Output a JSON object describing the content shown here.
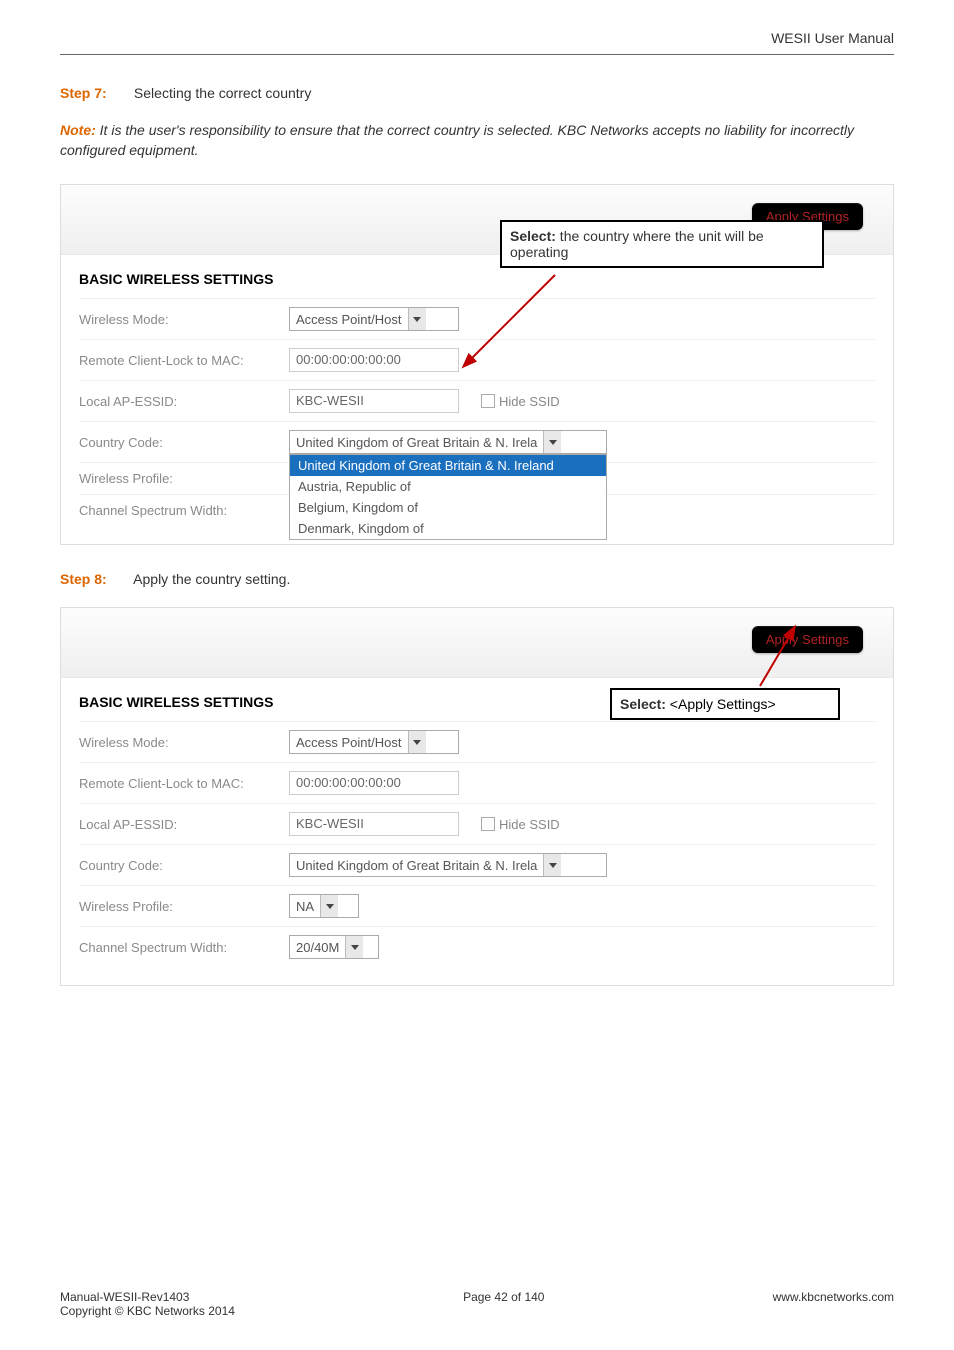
{
  "header": {
    "manual_title": "WESII User Manual"
  },
  "step7": {
    "label": "Step 7:",
    "text": "Selecting the correct country"
  },
  "note": {
    "label": "Note:",
    "text": "It is the user's responsibility to ensure that the correct country is selected. KBC Networks accepts no liability for incorrectly configured equipment."
  },
  "panel1": {
    "apply_label": "Apply Settings",
    "section_title": "BASIC WIRELESS SETTINGS",
    "rows": {
      "wireless_mode": {
        "label": "Wireless Mode:",
        "value": "Access Point/Host"
      },
      "remote_mac": {
        "label": "Remote Client-Lock to MAC:",
        "value": "00:00:00:00:00:00"
      },
      "local_essid": {
        "label": "Local AP-ESSID:",
        "value": "KBC-WESII",
        "hide_ssid": "Hide SSID"
      },
      "country_code": {
        "label": "Country Code:",
        "value": "United Kingdom of Great Britain & N. Irela"
      },
      "wireless_profile": {
        "label": "Wireless Profile:"
      },
      "channel_width": {
        "label": "Channel Spectrum Width:"
      }
    },
    "dropdown": {
      "opt_selected": "United Kingdom of Great Britain & N. Ireland",
      "opt2": "Austria, Republic of",
      "opt3": "Belgium, Kingdom of",
      "opt4": "Denmark, Kingdom of"
    },
    "callout": {
      "bold": "Select:",
      "text": " the country where the unit will be operating"
    }
  },
  "step8": {
    "label": "Step 8:",
    "text": "Apply the country setting."
  },
  "panel2": {
    "apply_label": "Apply Settings",
    "section_title": "BASIC WIRELESS SETTINGS",
    "rows": {
      "wireless_mode": {
        "label": "Wireless Mode:",
        "value": "Access Point/Host"
      },
      "remote_mac": {
        "label": "Remote Client-Lock to MAC:",
        "value": "00:00:00:00:00:00"
      },
      "local_essid": {
        "label": "Local AP-ESSID:",
        "value": "KBC-WESII",
        "hide_ssid": "Hide SSID"
      },
      "country_code": {
        "label": "Country Code:",
        "value": "United Kingdom of Great Britain & N. Irela"
      },
      "wireless_profile": {
        "label": "Wireless Profile:",
        "value": "NA"
      },
      "channel_width": {
        "label": "Channel Spectrum Width:",
        "value": "20/40M"
      }
    },
    "callout": {
      "bold": "Select:",
      "text": " <Apply Settings>"
    }
  },
  "footer": {
    "l1": "Manual-WESII-Rev1403",
    "l2": "Copyright © KBC Networks 2014",
    "center": "Page 42 of 140",
    "right": "www.kbcnetworks.com"
  }
}
